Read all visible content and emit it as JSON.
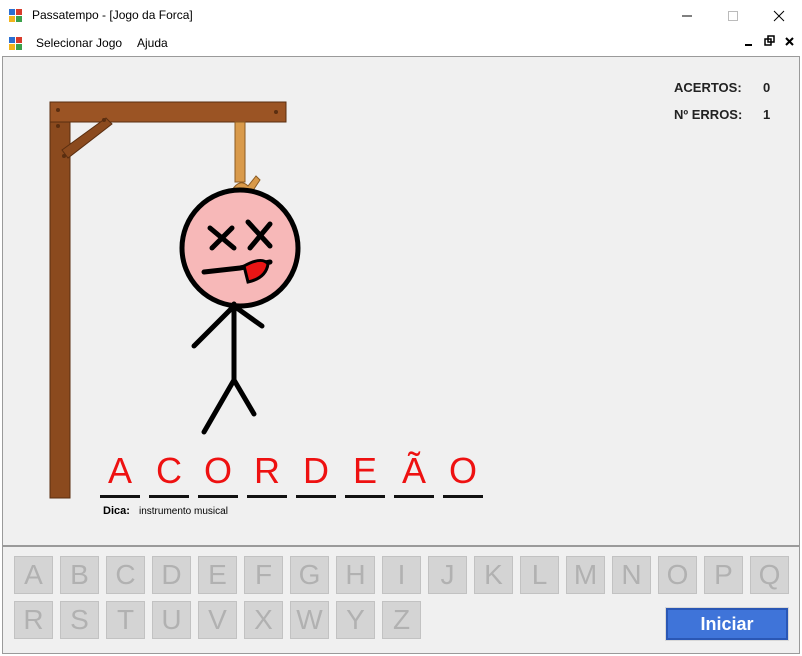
{
  "window": {
    "title": "Passatempo - [Jogo da Forca]"
  },
  "menu": {
    "items": [
      "Selecionar Jogo",
      "Ajuda"
    ]
  },
  "score": {
    "hits_label": "ACERTOS:",
    "hits_value": "0",
    "errors_label": "Nº ERROS:",
    "errors_value": "1"
  },
  "word": {
    "letters": [
      "A",
      "C",
      "O",
      "R",
      "D",
      "E",
      "Ã",
      "O"
    ]
  },
  "hint": {
    "label": "Dica:",
    "text": "instrumento musical"
  },
  "keyboard": {
    "row1": [
      "A",
      "B",
      "C",
      "D",
      "E",
      "F",
      "G",
      "H",
      "I",
      "J",
      "K",
      "L",
      "M",
      "N",
      "O",
      "P",
      "Q"
    ],
    "row2": [
      "R",
      "S",
      "T",
      "U",
      "V",
      "X",
      "W",
      "Y",
      "Z"
    ]
  },
  "start_button": {
    "label": "Iniciar"
  },
  "colors": {
    "letter": "#ee1111",
    "button": "#3f74d9",
    "face": "#f7b8b8",
    "gallows": "#8b4a1e"
  }
}
